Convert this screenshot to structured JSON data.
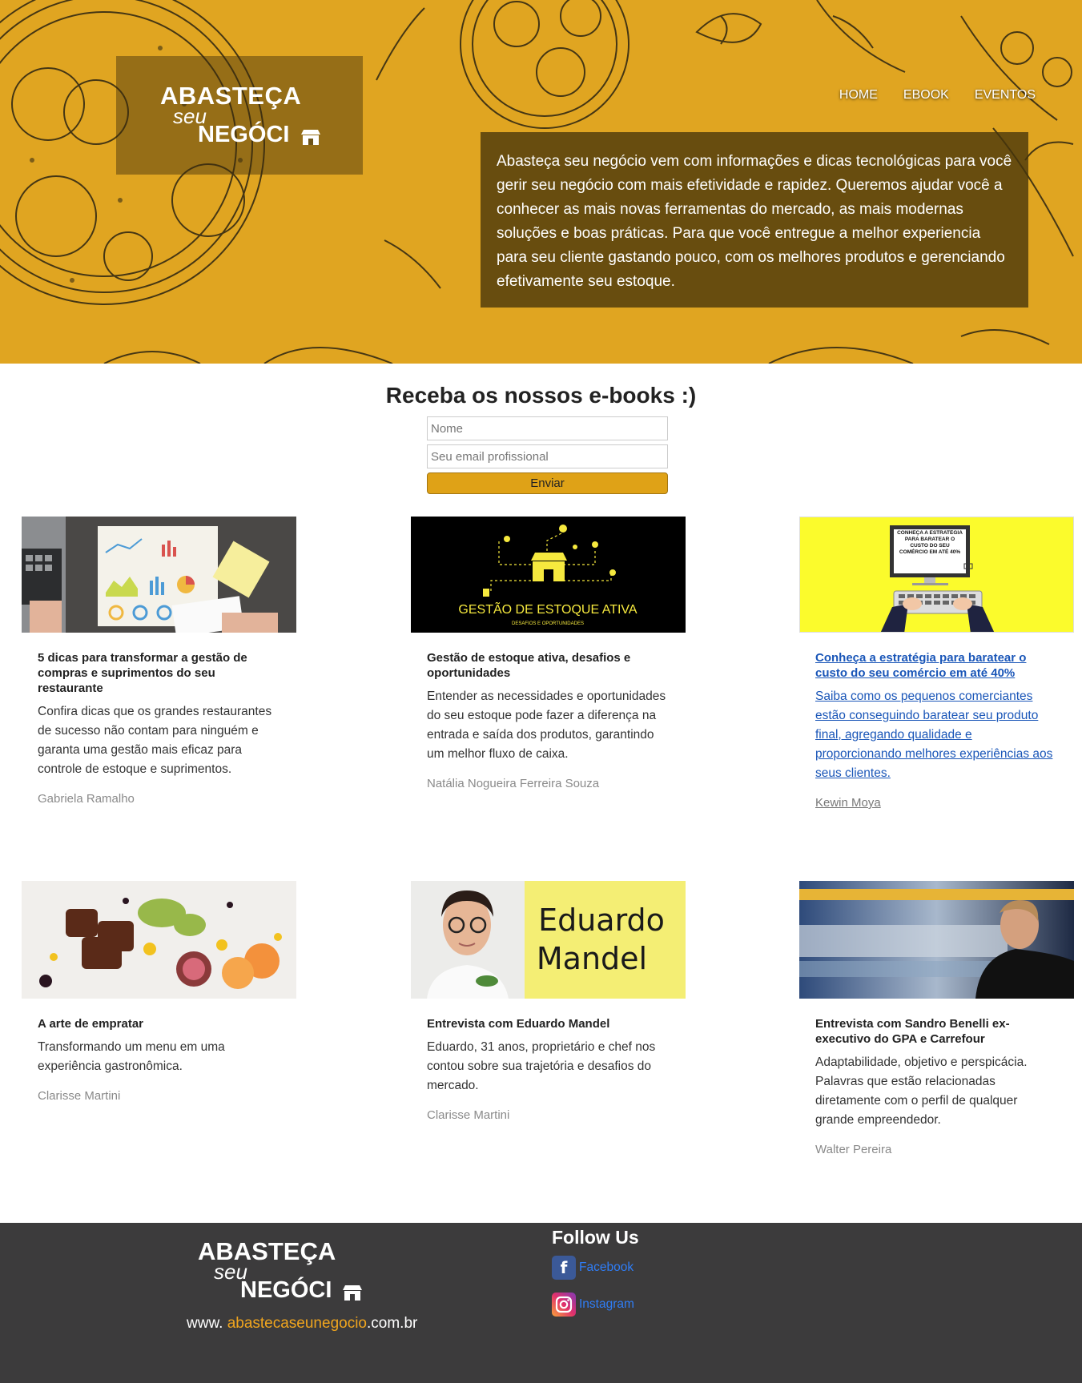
{
  "brand": {
    "line1": "ABASTEÇA",
    "line2": "seu",
    "line3": "NEGÓCI"
  },
  "nav": {
    "items": [
      "HOME",
      "EBOOK",
      "EVENTOS"
    ]
  },
  "hero": {
    "text": "Abasteça seu negócio vem com informações e dicas tecnológicas para você gerir seu negócio com mais efetividade e rapidez. Queremos ajudar você a conhecer as mais novas ferramentas do mercado, as mais modernas soluções e boas práticas. Para que você entregue a melhor experiencia para seu cliente gastando pouco, com os melhores produtos e gerenciando efetivamente seu estoque."
  },
  "newsletter": {
    "title": "Receba os nossos e-books :)",
    "name_placeholder": "Nome",
    "email_placeholder": "Seu email profissional",
    "submit_label": "Enviar"
  },
  "cards": [
    {
      "title": "5 dicas para transformar a gestão de compras e suprimentos do seu restaurante",
      "desc": "Confira dicas que os grandes restaurantes de sucesso não contam para ninguém e garanta uma gestão mais eficaz para controle de estoque e suprimentos.",
      "author": "Gabriela Ramalho"
    },
    {
      "title": "Gestão de estoque ativa, desafios e oportunidades",
      "desc": "Entender as necessidades e oportunidades do seu estoque pode fazer a diferença na entrada e saída dos produtos, garantindo um melhor fluxo de caixa.",
      "author": "Natália Nogueira Ferreira Souza",
      "image_title": "GESTÃO DE ESTOQUE ATIVA",
      "image_subtitle": "DESAFIOS E OPORTUNIDADES"
    },
    {
      "title": "Conheça a estratégia para baratear o custo do seu comércio em até 40%",
      "desc": "Saiba como os pequenos comerciantes estão conseguindo baratear seu produto final, agregando qualidade e proporcionando melhores experiências aos seus clientes.",
      "author": "Kewin Moya",
      "image_text": "CONHEÇA A ESTRATÉGIA PARA BARATEAR O CUSTO DO SEU COMÉRCIO EM ATÉ 40%"
    },
    {
      "title": "A arte de empratar",
      "desc": "Transformando um menu em uma experiência gastronômica.",
      "author": "Clarisse Martini"
    },
    {
      "title": "Entrevista com Eduardo Mandel",
      "desc": "Eduardo, 31 anos, proprietário e chef nos contou sobre sua trajetória e desafios do mercado.",
      "author": "Clarisse Martini",
      "image_name_1": "Eduardo",
      "image_name_2": "Mandel"
    },
    {
      "title": "Entrevista com Sandro Benelli ex-executivo do GPA e Carrefour",
      "desc": "Adaptabilidade, objetivo e perspicácia. Palavras que estão relacionadas diretamente com o perfil de qualquer grande empreendedor.",
      "author": "Walter Pereira"
    }
  ],
  "footer": {
    "site_prefix": "www.",
    "site_domain": "abastecaseunegocio",
    "site_suffix": ".com.br",
    "follow_title": "Follow Us",
    "facebook_label": "Facebook",
    "instagram_label": "Instagram"
  },
  "colors": {
    "hero_bg": "#e0a521",
    "accent": "#dfa217",
    "footer_bg": "#3c3b3c",
    "link": "#1a56b8"
  }
}
